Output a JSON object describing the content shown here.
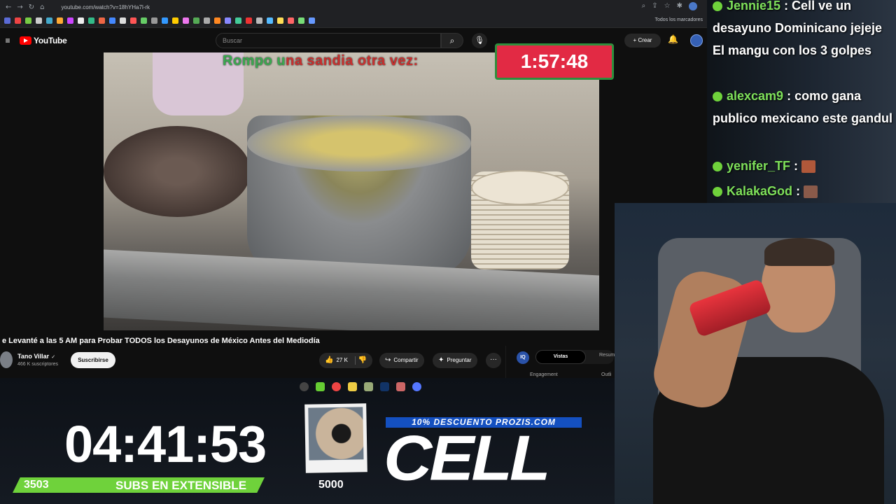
{
  "browser": {
    "url": "youtube.com/watch?v=18hYHa7l-rk",
    "bookmarks_all": "Todos los marcadores"
  },
  "youtube": {
    "logo_text": "YouTube",
    "search_placeholder": "Buscar",
    "create_label": "Crear"
  },
  "video": {
    "overlay_text": "Rompo una sandia otra vez:",
    "overlay_timer": "1:57:48",
    "title": "e Levanté a las 5 AM para Probar TODOS los Desayunos de México Antes del Mediodía",
    "channel": "Tano Villar",
    "subscribers": "466 K suscriptores",
    "subscribe_label": "Suscribirse",
    "likes": "27 K",
    "share_label": "Compartir",
    "ask_label": "Preguntar",
    "more_label": "···"
  },
  "side_panel": {
    "badge": "IQ",
    "tab_active": "Vistas",
    "tab_other": "Resum",
    "engagement": "Engagement",
    "outline": "Outli"
  },
  "stream": {
    "main_timer": "04:41:53",
    "subs_count": "3503",
    "subs_label": "SUBS EN EXTENSIBLE",
    "subs_goal": "5000",
    "subs_progress": 0.7,
    "promo": "10% DESCUENTO PROZIS.COM",
    "logo": "CELL"
  },
  "chat": [
    {
      "user": "Jennie15",
      "text": ": Cell ve un desayuno Dominicano jejeje El mangu con los 3 golpes"
    },
    {
      "user": "alexcam9",
      "text": ": como gana publico mexicano este gandul"
    },
    {
      "user": "yenifer_TF",
      "text": ":"
    },
    {
      "user": "KalakaGod",
      "text": ":"
    }
  ],
  "colors": {
    "accent_green": "#6fd23b",
    "timer_red": "#e22a44",
    "promo_blue": "#1450c0",
    "yt_red": "#ff0000"
  }
}
